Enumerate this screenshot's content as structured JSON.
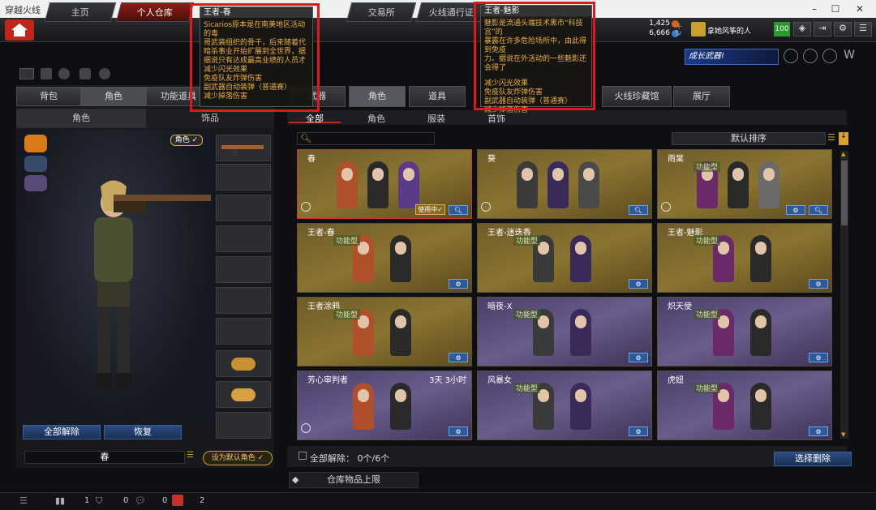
{
  "window": {
    "title": "穿越火线"
  },
  "topnav": {
    "tabs": [
      "主页",
      "个人仓库",
      "交易所",
      "火线通行证"
    ],
    "currency1": "1,425",
    "currency2": "6,666",
    "username": "拿她风筝的人",
    "level": "100"
  },
  "banner": {
    "text": "成长武器!"
  },
  "left": {
    "tabs": [
      "背包",
      "角色",
      "功能道具"
    ],
    "subtabs": [
      "角色",
      "饰品"
    ],
    "role_badge": "角色 ✓",
    "btn_unequip_all": "全部解除",
    "btn_restore": "恢复",
    "char_name": "春",
    "btn_default": "设为默认角色 ✓"
  },
  "main": {
    "tabs": [
      "武器",
      "角色",
      "道具",
      "火线珍藏馆",
      "展厅"
    ],
    "filters": [
      "全部",
      "角色",
      "服装",
      "首饰"
    ],
    "sort_label": "默认排序",
    "footer_unequip": "全部解除： 0个/6个",
    "btn_select_delete": "选择删除",
    "storage_limit": "仓库物品上限"
  },
  "cards": [
    {
      "name": "春",
      "style": "gold",
      "badge": "",
      "extra": "使用中✓",
      "selected": true
    },
    {
      "name": "葵",
      "style": "gold",
      "badge": "",
      "extra": "",
      "selected": false
    },
    {
      "name": "雨棠",
      "style": "gold",
      "badge": "功能型",
      "extra": "",
      "selected": false
    },
    {
      "name": "王者-春",
      "style": "gold",
      "badge": "功能型",
      "extra": "",
      "selected": false
    },
    {
      "name": "王者-迷迭香",
      "style": "gold",
      "badge": "功能型",
      "extra": "",
      "selected": false
    },
    {
      "name": "王者-魅影",
      "style": "gold",
      "badge": "功能型",
      "extra": "",
      "selected": false
    },
    {
      "name": "王者涂鸦",
      "style": "gold",
      "badge": "功能型",
      "extra": "",
      "selected": false
    },
    {
      "name": "暗夜-X",
      "style": "purple",
      "badge": "功能型",
      "extra": "",
      "selected": false
    },
    {
      "name": "炽天使",
      "style": "purple",
      "badge": "功能型",
      "extra": "",
      "selected": false
    },
    {
      "name": "芳心审判者",
      "style": "purple",
      "badge": "",
      "extra": "",
      "duration": "3天 3小时",
      "selected": false
    },
    {
      "name": "风暴女",
      "style": "purple",
      "badge": "功能型",
      "extra": "",
      "selected": false
    },
    {
      "name": "虎妞",
      "style": "purple",
      "badge": "功能型",
      "extra": "",
      "selected": false
    }
  ],
  "tooltips": [
    {
      "title": "王者-春",
      "lines": [
        "Sicarios原本是在南美地区活动的毒",
        "哥武装组织的骨干，后来随着代",
        "暗杀事业开始扩展到全世界，据",
        "据说只有达成最高业绩的人员才",
        "减少闪光效果",
        "免疫队友炸弹伤害",
        "副武器自动装弹（普通赛）",
        "减少掉落伤害"
      ]
    },
    {
      "title": "王者-魅影",
      "lines": [
        "魅影是流通头端技术黑市“科技宫”的",
        "暴露在许多危险场所中，由此得到免疫",
        "力。据说在外活动的一些魅影还会得了",
        "",
        "减少闪光效果",
        "免疫队友炸弹伤害",
        "副武器自动装弹（普通赛）",
        "减少掉落伤害"
      ]
    }
  ],
  "bottombar": {
    "count1": "1",
    "count2": "0",
    "count3": "0",
    "count4": "2"
  },
  "colors": {
    "accent_red": "#c0271b",
    "gold": "#8a7430",
    "purple": "#6a5c8c",
    "blue_btn": "#2c5a9a"
  }
}
